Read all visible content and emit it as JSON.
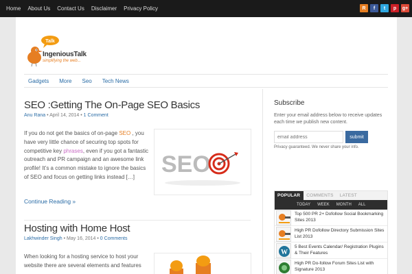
{
  "topnav": [
    "Home",
    "About Us",
    "Contact Us",
    "Disclaimer",
    "Privacy Policy"
  ],
  "social": [
    {
      "icon": "rss-icon",
      "glyph": "R",
      "color": "#e67e22"
    },
    {
      "icon": "facebook-icon",
      "glyph": "f",
      "color": "#3b5998"
    },
    {
      "icon": "twitter-icon",
      "glyph": "t",
      "color": "#2ea7e0"
    },
    {
      "icon": "pinterest-icon",
      "glyph": "p",
      "color": "#cb2027"
    },
    {
      "icon": "googleplus-icon",
      "glyph": "g+",
      "color": "#dd4b39"
    }
  ],
  "logo": {
    "bubble": "Talk",
    "name": "IngeniousTalk",
    "tagline": "simplifying the web..."
  },
  "categories": [
    "Gadgets",
    "More",
    "Seo",
    "Tech News"
  ],
  "posts": [
    {
      "title": "SEO :Getting The On-Page SEO Basics",
      "author": "Anu Rana",
      "date": "April 14, 2014",
      "comments": "1 Comment",
      "excerpt_a": "If you do not get the basics of on-page ",
      "link1": "SEO",
      "excerpt_b": " , you have very little chance of securing top spots for competitive key ",
      "link2": "phrases",
      "excerpt_c": ", even if you got a fantastic outreach and PR campaign and an awesome link profile! It’s a common mistake to ignore the basics of SEO and focus on getting links instead […]",
      "continue": "Continue Reading »",
      "thumb_text": "SEO"
    },
    {
      "title": "Hosting with Home Host",
      "author": "Lakhwinder Singh",
      "date": "May 16, 2014",
      "comments": "0 Comments",
      "excerpt": "When looking for a hosting service to host your website there are several elements and features"
    }
  ],
  "sidebar": {
    "subscribe": {
      "title": "Subscribe",
      "desc": "Enter your email address below to receive updates each time we publish new content.",
      "placeholder": "email address",
      "button": "submit",
      "note": "Privacy guaranteed. We never share your info."
    },
    "tabs": [
      "POPULAR",
      "COMMENTS",
      "LATEST"
    ],
    "subtabs": [
      "TODAY",
      "WEEK",
      "MONTH",
      "ALL"
    ],
    "popular": [
      {
        "title": "Top 500 PR 2+ Dofollow Social Bookmarking Sites 2013"
      },
      {
        "title": "High PR Dofollow Directory Submission Sites List 2013"
      },
      {
        "title": "5 Best Events Calendar/ Registration Plugins & Their Features"
      },
      {
        "title": "High PR Do-follow Forum Sites List with Signature 2013"
      }
    ]
  }
}
